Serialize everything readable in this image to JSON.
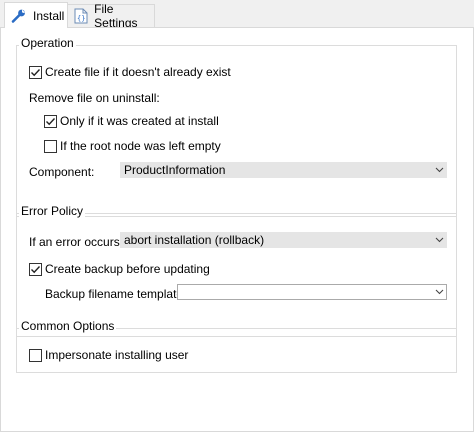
{
  "tabs": [
    {
      "label": "Install",
      "icon": "wrench-icon",
      "active": true
    },
    {
      "label": "File Settings",
      "icon": "json-file-icon",
      "active": false
    }
  ],
  "operation": {
    "title": "Operation",
    "create_file": {
      "label": "Create file if it doesn't already exist",
      "checked": true
    },
    "remove_label": "Remove file on uninstall:",
    "only_if_created": {
      "label": "Only if it was created at install",
      "checked": true
    },
    "if_root_empty": {
      "label": "If the root node was left empty",
      "checked": false
    },
    "component_label": "Component:",
    "component_value": "ProductInformation"
  },
  "error_policy": {
    "title": "Error Policy",
    "error_label": "If an error occurs:",
    "error_value": "abort installation (rollback)",
    "create_backup": {
      "label": "Create backup before updating",
      "checked": true
    },
    "backup_template_label": "Backup filename template:",
    "backup_template_value": ""
  },
  "common": {
    "title": "Common Options",
    "impersonate": {
      "label": "Impersonate installing user",
      "checked": false
    }
  },
  "colors": {
    "accent_blue": "#2b6cc4",
    "border": "#dcdcdc",
    "combo_bg": "#e5e5e5"
  }
}
